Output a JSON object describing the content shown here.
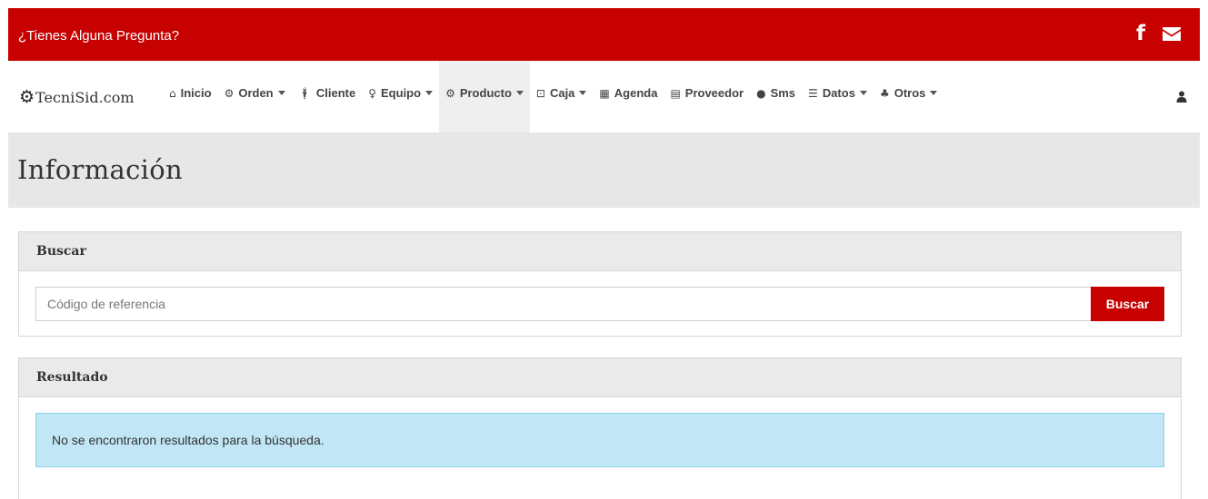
{
  "topbar": {
    "question": "¿Tienes Alguna Pregunta?",
    "facebook_icon": "facebook-icon",
    "mail_icon": "envelope-icon",
    "color": "#c70000"
  },
  "brand": {
    "name": "TecniSid.com",
    "icon": "cog-icon"
  },
  "nav": {
    "items": [
      {
        "label": "Inicio",
        "icon": "home-icon",
        "dropdown": false
      },
      {
        "label": "Orden",
        "icon": "cog-icon",
        "dropdown": true
      },
      {
        "label": "Cliente",
        "icon": "person-icon",
        "dropdown": false
      },
      {
        "label": "Equipo",
        "icon": "lightbulb-icon",
        "dropdown": true
      },
      {
        "label": "Producto",
        "icon": "cogs-icon",
        "dropdown": true,
        "active": true
      },
      {
        "label": "Caja",
        "icon": "money-icon",
        "dropdown": true
      },
      {
        "label": "Agenda",
        "icon": "calendar-icon",
        "dropdown": false
      },
      {
        "label": "Proveedor",
        "icon": "building-icon",
        "dropdown": false
      },
      {
        "label": "Sms",
        "icon": "comment-icon",
        "dropdown": false
      },
      {
        "label": "Datos",
        "icon": "list-icon",
        "dropdown": true
      },
      {
        "label": "Otros",
        "icon": "sitemap-icon",
        "dropdown": true
      }
    ],
    "user_icon": "user-icon"
  },
  "page": {
    "title": "Información"
  },
  "search": {
    "heading": "Buscar",
    "placeholder": "Código de referencia",
    "value": "",
    "button_label": "Buscar"
  },
  "result": {
    "heading": "Resultado",
    "message": "No se encontraron resultados para la búsqueda."
  }
}
